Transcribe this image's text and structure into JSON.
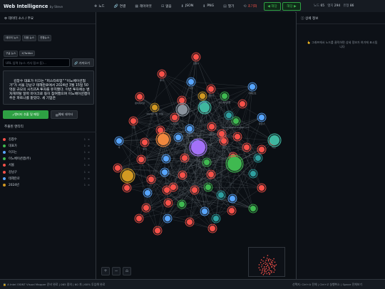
{
  "app": {
    "title": "Web Intelligence",
    "by": "by Steve"
  },
  "toolbar": {
    "items": [
      {
        "icon": "✚",
        "label": "노드"
      },
      {
        "icon": "🔗",
        "label": "연결"
      },
      {
        "icon": "▦",
        "label": "레이아웃"
      },
      {
        "icon": "⊟",
        "label": "없음"
      },
      {
        "icon": "⬇",
        "label": "JSON"
      },
      {
        "icon": "⬇",
        "label": "PNG"
      },
      {
        "icon": "▤",
        "label": "열기"
      },
      {
        "icon": "⟲",
        "label": "초기화"
      }
    ],
    "prev_label": "◀ 해당",
    "next_label": "해당 ▶",
    "stats": {
      "nodes_label": "노드",
      "nodes": "65",
      "edges_label": "엣지",
      "edges": "294",
      "type_label": "유형",
      "types": "86"
    }
  },
  "sidebar": {
    "source_header": "데이터 소스 / 주요",
    "chips": [
      "데이터 뉴스",
      "다음 뉴스",
      "연합뉴스",
      "구글 뉴스",
      "X/Twitter"
    ],
    "url_placeholder": "URL 입력 (뉴스 기사 링크 등)...",
    "url_button": "가져오기",
    "article_text": "김창수 대표가 이끄는 \"피스타트업\" \"이노베이션협가\"가 서울 강남구 테헤란로에서 2024년 3월 15일 50억원 규모의 시리즈A 투자를 유치했다. 이번 투자에는 벤처캐피탈 알파 마이크로 등이 참여했으며 이노베이션랩이 주관 파트너를 맡았다. 세 기업은",
    "analyze_button": "엔티티 추출 및 매핑",
    "sample_button": "예제 데이터",
    "entity_header": "추출된 엔티티",
    "entities": [
      {
        "name": "김창수",
        "color": "#f85149",
        "count": "1"
      },
      {
        "name": "대표가",
        "color": "#3fb950",
        "count": "1"
      },
      {
        "name": "이끄는",
        "color": "#58a6ff",
        "count": "1"
      },
      {
        "name": "이노베이션랩(주)",
        "color": "#3fb950",
        "count": "1"
      },
      {
        "name": "서울",
        "color": "#f85149",
        "count": "1"
      },
      {
        "name": "강남구",
        "color": "#f85149",
        "count": "1"
      },
      {
        "name": "테헤란로",
        "color": "#58a6ff",
        "count": "1"
      },
      {
        "name": "2024년",
        "color": "#d29922",
        "count": "1"
      }
    ]
  },
  "graph": {
    "nodes": [
      {
        "label": "김창수",
        "color": "#f85149"
      },
      {
        "label": "투자",
        "color": "#f85149"
      },
      {
        "label": "서울",
        "color": "#58a6ff"
      },
      {
        "label": "강남구",
        "color": "#f85149"
      },
      {
        "label": "테헤란로",
        "color": "#58a6ff"
      },
      {
        "label": "이노베이션랩",
        "color": "#3fb950"
      },
      {
        "label": "벤처캐피탈",
        "color": "#f85149"
      },
      {
        "label": "알파",
        "color": "#f85149"
      },
      {
        "label": "마이크로",
        "color": "#58a6ff"
      },
      {
        "label": "2024년 3월 15일",
        "color": "#d29922"
      },
      {
        "label": "50억원",
        "color": "#d29922"
      },
      {
        "label": "시리즈A",
        "color": "#f85149"
      },
      {
        "label": "파트너",
        "color": "#58a6ff"
      },
      {
        "label": "innovation@startup.com",
        "color": "#3fb950"
      },
      {
        "label": "대표가",
        "color": "#f85149"
      },
      {
        "label": "기업",
        "color": "#f85149"
      },
      {
        "label": "참여",
        "color": "#f85149"
      },
      {
        "label": "주관",
        "color": "#58a6ff"
      },
      {
        "label": "이끄는",
        "color": "#58a6ff"
      },
      {
        "label": "유치",
        "color": "#f85149"
      },
      {
        "label": "규모",
        "color": "#f85149"
      },
      {
        "label": "이번",
        "color": "#f85149"
      },
      {
        "label": "세",
        "color": "#58a6ff"
      },
      {
        "label": "등이",
        "color": "#f85149"
      }
    ]
  },
  "right_panel": {
    "header": "상세 정보",
    "message": "👆 그래프에서 노드를 클릭하면 상세 정보가 여기에 표시됩니다"
  },
  "status": {
    "left": "🔒 A Intel OSINT Visual Mapper 준비 완료 | 065 중의 | 60 개 | 60% 투입해 완료",
    "right": "선택지: Ctrl+A 전체 | Ctrl+Z 실행취소 | Space 전체보기"
  },
  "zoom": {
    "in": "+",
    "out": "−",
    "fit": "⌂"
  }
}
